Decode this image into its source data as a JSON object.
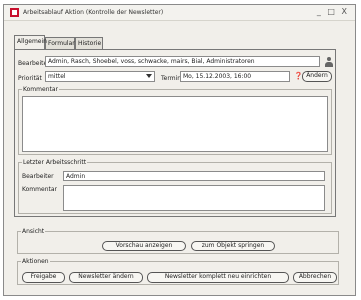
{
  "window": {
    "title": "Arbeitsablauf Aktion (Kontrolle der Newsletter)",
    "controls": "_ □ X"
  },
  "tabs": [
    "Allgemein",
    "Formular",
    "Historie"
  ],
  "general": {
    "bearbeiter_label": "Bearbeiter",
    "bearbeiter_value": "Admin, Rasch, Shoebel, voss, schwacke, mairs, Bial, Administratoren",
    "prioritaet_label": "Priorität",
    "prioritaet_value": "mittel",
    "termin_label": "Termin",
    "termin_value": "Mo, 15.12.2003, 16:00",
    "aendern_label": "Ändern",
    "kommentar_group": "Kommentar",
    "letzter_group": "Letzter Arbeitsschritt",
    "letzter_bearbeiter_label": "Bearbeiter",
    "letzter_bearbeiter_value": "Admin",
    "letzter_kommentar_label": "Kommentar"
  },
  "ansicht": {
    "title": "Ansicht",
    "vorschau": "Vorschau anzeigen",
    "zum_objekt": "zum Objekt springen"
  },
  "aktionen": {
    "title": "Aktionen",
    "freigabe": "Freigabe",
    "newsletter_aendern": "Newsletter ändern",
    "newsletter_neu": "Newsletter komplett neu einrichten",
    "abbrechen": "Abbrechen"
  },
  "colors": {
    "brand_icon": "#c8102e",
    "window_bg": "#f1efea"
  }
}
